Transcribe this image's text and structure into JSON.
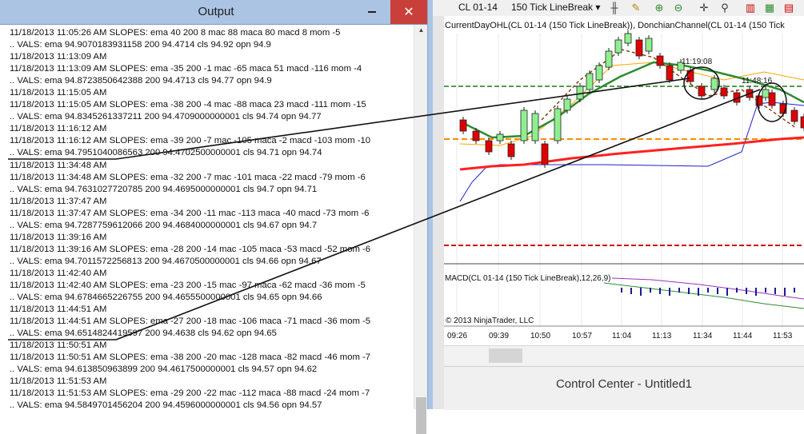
{
  "output_window": {
    "title": "Output",
    "close_glyph": "✕",
    "lines": [
      "11/18/2013 11:05:26 AM SLOPES: ema 40 200 8 mac 88 maca 80 macd 8 mom -5",
      " .. VALS: ema 94.9070183931158 200 94.4714 cls 94.92 opn 94.9",
      "11/18/2013 11:13:09 AM",
      "11/18/2013 11:13:09 AM SLOPES: ema -35 200 -1 mac -65 maca 51 macd -116 mom -4",
      " .. VALS: ema 94.8723850642388 200 94.4713 cls 94.77 opn 94.9",
      "11/18/2013 11:15:05 AM",
      "11/18/2013 11:15:05 AM SLOPES: ema -38 200 -4 mac -88 maca 23 macd -111 mom -15",
      " .. VALS: ema 94.8345261337211 200 94.4709000000001 cls 94.74 opn 94.77",
      "11/18/2013 11:16:12 AM",
      "11/18/2013 11:16:12 AM SLOPES: ema -39 200 -7 mac -105 maca -2 macd -103 mom -10",
      " .. VALS: ema 94.7951040086563 200 94.4702500000001 cls 94.71 opn 94.74",
      "11/18/2013 11:34:48 AM",
      "11/18/2013 11:34:48 AM SLOPES: ema -32 200 -7 mac -101 maca -22 macd -79 mom -6",
      " .. VALS: ema 94.7631027720785 200 94.4695000000001 cls 94.7 opn 94.71",
      "11/18/2013 11:37:47 AM",
      "11/18/2013 11:37:47 AM SLOPES: ema -34 200 -11 mac -113 maca -40 macd -73 mom -6",
      " .. VALS: ema 94.7287759612066 200 94.4684000000001 cls 94.67 opn 94.7",
      "11/18/2013 11:39:16 AM",
      "11/18/2013 11:39:16 AM SLOPES: ema -28 200 -14 mac -105 maca -53 macd -52 mom -6",
      " .. VALS: ema 94.7011572256813 200 94.4670500000001 cls 94.66 opn 94.67",
      "11/18/2013 11:42:40 AM",
      "11/18/2013 11:42:40 AM SLOPES: ema -23 200 -15 mac -97 maca -62 macd -36 mom -5",
      " .. VALS: ema 94.6784665226755 200 94.4655500000001 cls 94.65 opn 94.66",
      "11/18/2013 11:44:51 AM",
      "11/18/2013 11:44:51 AM SLOPES: ema -27 200 -18 mac -106 maca -71 macd -36 mom -5",
      " .. VALS: ema 94.6514824419597 200 94.4638 cls 94.62 opn 94.65",
      "11/18/2013 11:50:51 AM",
      "11/18/2013 11:50:51 AM SLOPES: ema -38 200 -20 mac -128 maca -82 macd -46 mom -7",
      " .. VALS: ema 94.613850963899 200 94.4617500000001 cls 94.57 opn 94.62",
      "11/18/2013 11:51:53 AM",
      "11/18/2013 11:51:53 AM SLOPES: ema -29 200 -22 mac -112 maca -88 macd -24 mom -7",
      " .. VALS: ema 94.5849701456204 200 94.4596000000001 cls 94.56 opn 94.57"
    ]
  },
  "chart_window": {
    "instrument": "CL 01-14",
    "chart_type": "150 Tick LineBreak",
    "dropdown_glyph": "▾",
    "indicator_label": "CurrentDayOHL(CL 01-14 (150 Tick LineBreak)), DonchianChannel(CL 01-14 (150 Tick",
    "macd_label": "MACD(CL 01-14 (150 Tick LineBreak),12,26,9)",
    "copyright": "© 2013 NinjaTrader, LLC",
    "annotations": [
      "11:19:08",
      "11:48:16"
    ],
    "time_ticks": [
      "09:26",
      "09:39",
      "10:50",
      "10:57",
      "11:04",
      "11:13",
      "11:34",
      "11:44",
      "11:53"
    ],
    "colors": {
      "bull_candle": "#90ee90",
      "bear_candle": "#e00000",
      "ema_fast": "#2e8b2e",
      "ema_slow": "#ff2020",
      "donchian": "#ffa500",
      "open_level": "#ff8c00",
      "low_level": "#cc0000",
      "signal_line": "#2020cc"
    }
  },
  "status_bar": {
    "control_center_title": "Control Center - Untitled1"
  }
}
